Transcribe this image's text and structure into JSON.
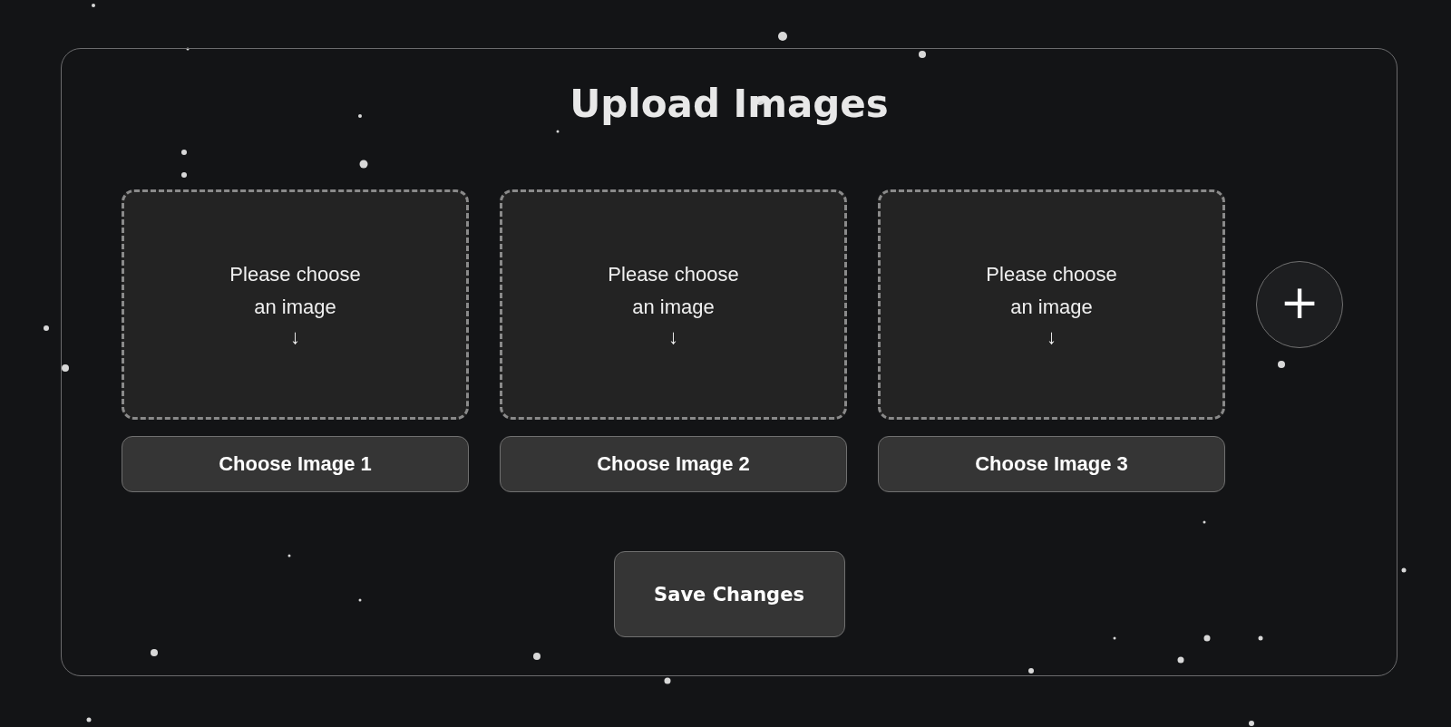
{
  "title": "Upload Images",
  "slots": [
    {
      "prompt": "Please choose an image",
      "arrow": "↓",
      "button": "Choose Image 1"
    },
    {
      "prompt": "Please choose an image",
      "arrow": "↓",
      "button": "Choose Image 2"
    },
    {
      "prompt": "Please choose an image",
      "arrow": "↓",
      "button": "Choose Image 3"
    }
  ],
  "add_button": "+",
  "save_button": "Save Changes"
}
